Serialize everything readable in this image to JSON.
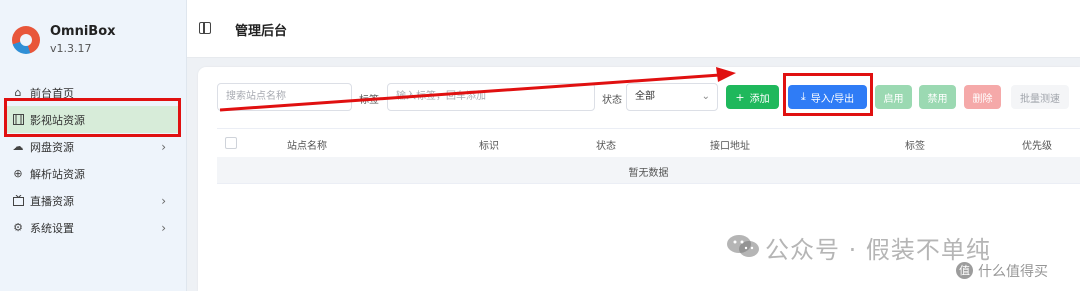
{
  "app": {
    "name": "OmniBox",
    "version": "v1.3.17"
  },
  "sidebar": {
    "items": [
      {
        "label": "前台首页",
        "icon": "home-icon"
      },
      {
        "label": "影视站资源",
        "icon": "film-icon",
        "active": true
      },
      {
        "label": "网盘资源",
        "icon": "cloud-icon",
        "submenu": true
      },
      {
        "label": "解析站资源",
        "icon": "globe-icon"
      },
      {
        "label": "直播资源",
        "icon": "tv-icon",
        "submenu": true
      },
      {
        "label": "系统设置",
        "icon": "gear-icon",
        "submenu": true
      }
    ]
  },
  "header": {
    "title": "管理后台"
  },
  "toolbar": {
    "search_placeholder": "搜索站点名称",
    "tag_label": "标签",
    "tag_placeholder": "输入标签，回车添加",
    "status_label": "状态",
    "status_value": "全部",
    "buttons": {
      "add": "添加",
      "import_export": "导入/导出",
      "enable": "启用",
      "disable": "禁用",
      "delete": "删除",
      "batch_test": "批量测速"
    }
  },
  "table": {
    "columns": [
      "站点名称",
      "标识",
      "状态",
      "接口地址",
      "标签",
      "优先级"
    ],
    "empty_text": "暂无数据"
  },
  "watermark": {
    "main": "公众号 · 假装不单纯",
    "badge": "值",
    "secondary": "什么值得买"
  },
  "colors": {
    "highlight": "#e01010",
    "add_button": "#1fb85c",
    "primary_button": "#2f7cf6",
    "enable_button": "#9bd9b2",
    "disable_button": "#9bd9b2",
    "delete_button": "#f5a9a9",
    "active_nav": "#d7ecd9"
  }
}
